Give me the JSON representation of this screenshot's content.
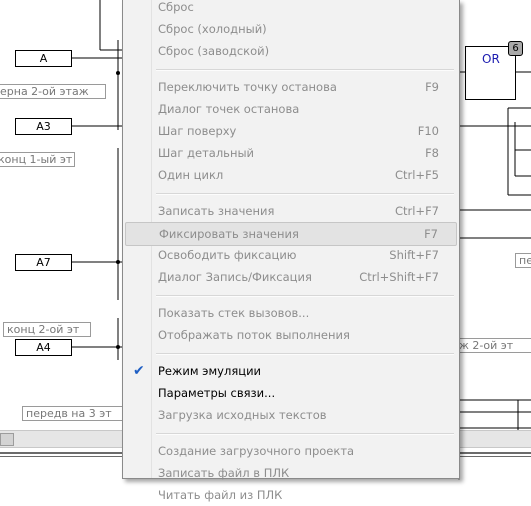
{
  "diagram": {
    "inputs": [
      {
        "label": "A"
      },
      {
        "label": "A3"
      },
      {
        "label": "A7"
      },
      {
        "label": "A4"
      }
    ],
    "comments_left": [
      {
        "text": "ерна 2-ой этаж"
      },
      {
        "text": "конц 1-ый эт"
      },
      {
        "text": "конц 2-ой эт"
      },
      {
        "text": "передв на 3 эт"
      }
    ],
    "comments_right": [
      {
        "text": "пе"
      },
      {
        "text": "ж 2-ой эт"
      }
    ],
    "or_block": {
      "label": "OR",
      "badge": "6"
    }
  },
  "context_menu": {
    "groups": [
      [
        {
          "label": "Сброс",
          "shortcut": "",
          "state": "disabled"
        },
        {
          "label": "Сброс (холодный)",
          "shortcut": "",
          "state": "disabled"
        },
        {
          "label": "Сброс (заводской)",
          "shortcut": "",
          "state": "disabled"
        }
      ],
      [
        {
          "label": "Переключить точку останова",
          "shortcut": "F9",
          "state": "disabled"
        },
        {
          "label": "Диалог точек останова",
          "shortcut": "",
          "state": "disabled"
        },
        {
          "label": "Шаг поверху",
          "shortcut": "F10",
          "state": "disabled"
        },
        {
          "label": "Шаг детальный",
          "shortcut": "F8",
          "state": "disabled"
        },
        {
          "label": "Один цикл",
          "shortcut": "Ctrl+F5",
          "state": "disabled"
        }
      ],
      [
        {
          "label": "Записать значения",
          "shortcut": "Ctrl+F7",
          "state": "disabled"
        },
        {
          "label": "Фиксировать значения",
          "shortcut": "F7",
          "state": "disabled",
          "highlighted": true
        },
        {
          "label": "Освободить фиксацию",
          "shortcut": "Shift+F7",
          "state": "disabled"
        },
        {
          "label": "Диалог Запись/Фиксация",
          "shortcut": "Ctrl+Shift+F7",
          "state": "disabled"
        }
      ],
      [
        {
          "label": "Показать стек вызовов...",
          "shortcut": "",
          "state": "disabled"
        },
        {
          "label": "Отображать поток выполнения",
          "shortcut": "",
          "state": "disabled"
        }
      ],
      [
        {
          "label": "Режим эмуляции",
          "shortcut": "",
          "state": "enabled",
          "checked": true
        },
        {
          "label": "Параметры связи...",
          "shortcut": "",
          "state": "enabled"
        },
        {
          "label": "Загрузка исходных текстов",
          "shortcut": "",
          "state": "disabled"
        }
      ],
      [
        {
          "label": "Создание загрузочного проекта",
          "shortcut": "",
          "state": "disabled"
        },
        {
          "label": "Записать файл в ПЛК",
          "shortcut": "",
          "state": "disabled"
        },
        {
          "label": "Читать файл из ПЛК",
          "shortcut": "",
          "state": "disabled"
        }
      ]
    ]
  }
}
